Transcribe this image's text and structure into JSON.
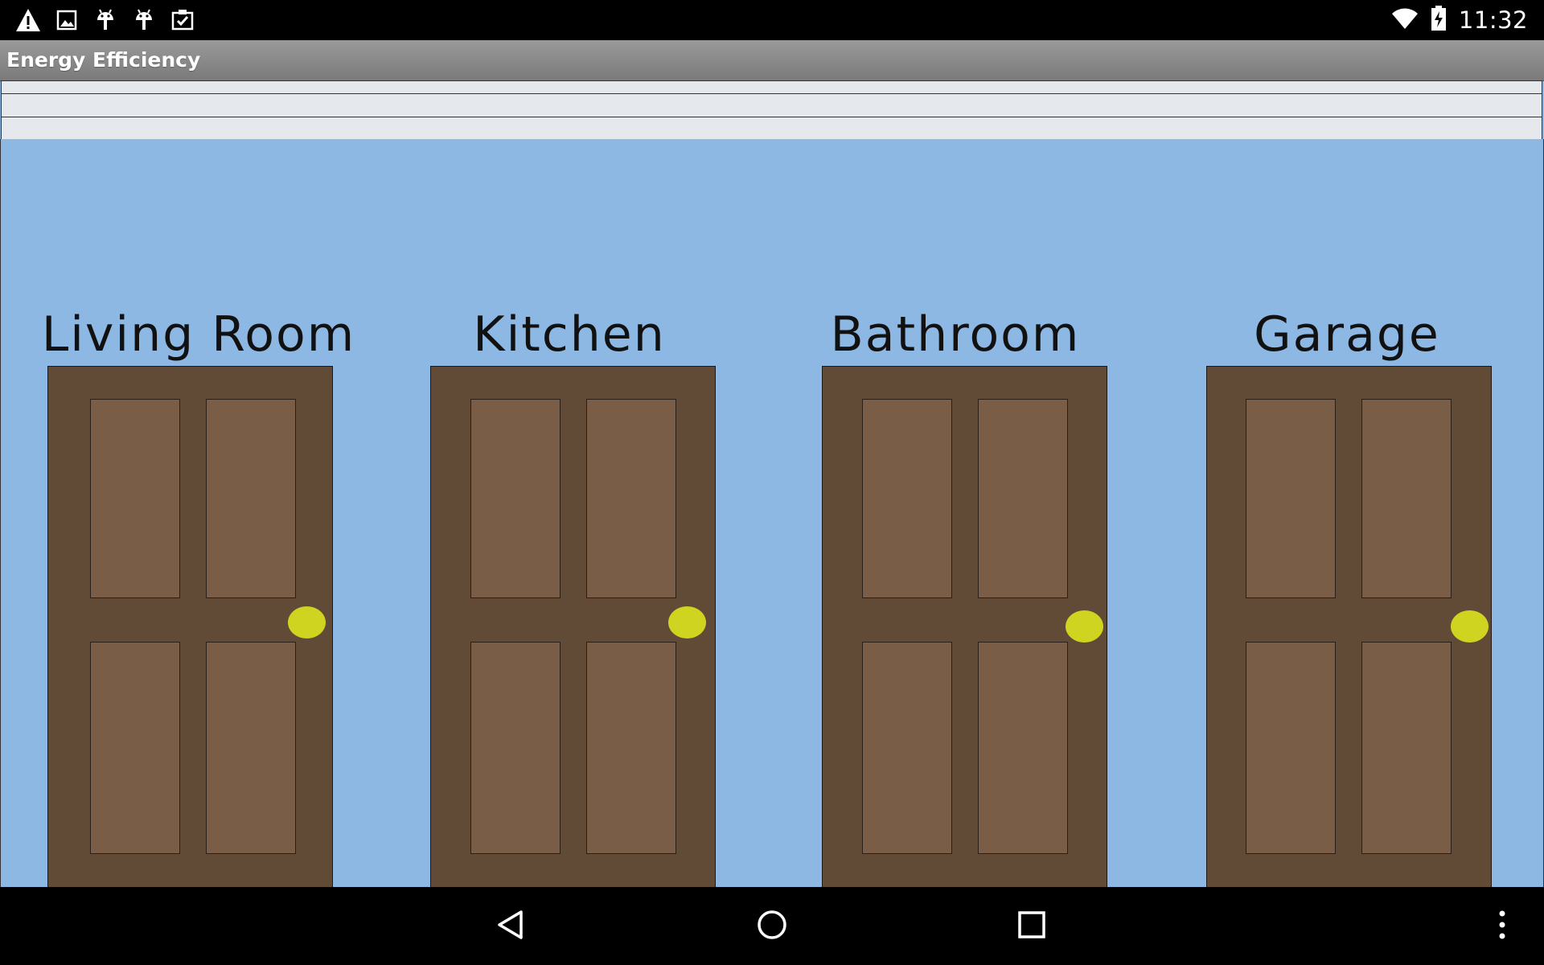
{
  "status_bar": {
    "icons_left": [
      "warning-icon",
      "image-icon",
      "android-icon",
      "android-icon",
      "clipboard-check-icon"
    ],
    "icons_right": [
      "wifi-icon",
      "battery-charging-icon"
    ],
    "time": "11:32"
  },
  "app": {
    "title": "Energy Efficiency"
  },
  "rooms": [
    {
      "label": "Living Room"
    },
    {
      "label": "Kitchen"
    },
    {
      "label": "Bathroom"
    },
    {
      "label": "Garage"
    }
  ],
  "colors": {
    "wall": "#8db8e4",
    "door_frame": "#614b37",
    "door_panel": "#795d47",
    "door_knob": "#cfd421"
  },
  "nav_bar": {
    "buttons": [
      "back-icon",
      "home-icon",
      "recents-icon",
      "overflow-menu-icon"
    ]
  }
}
